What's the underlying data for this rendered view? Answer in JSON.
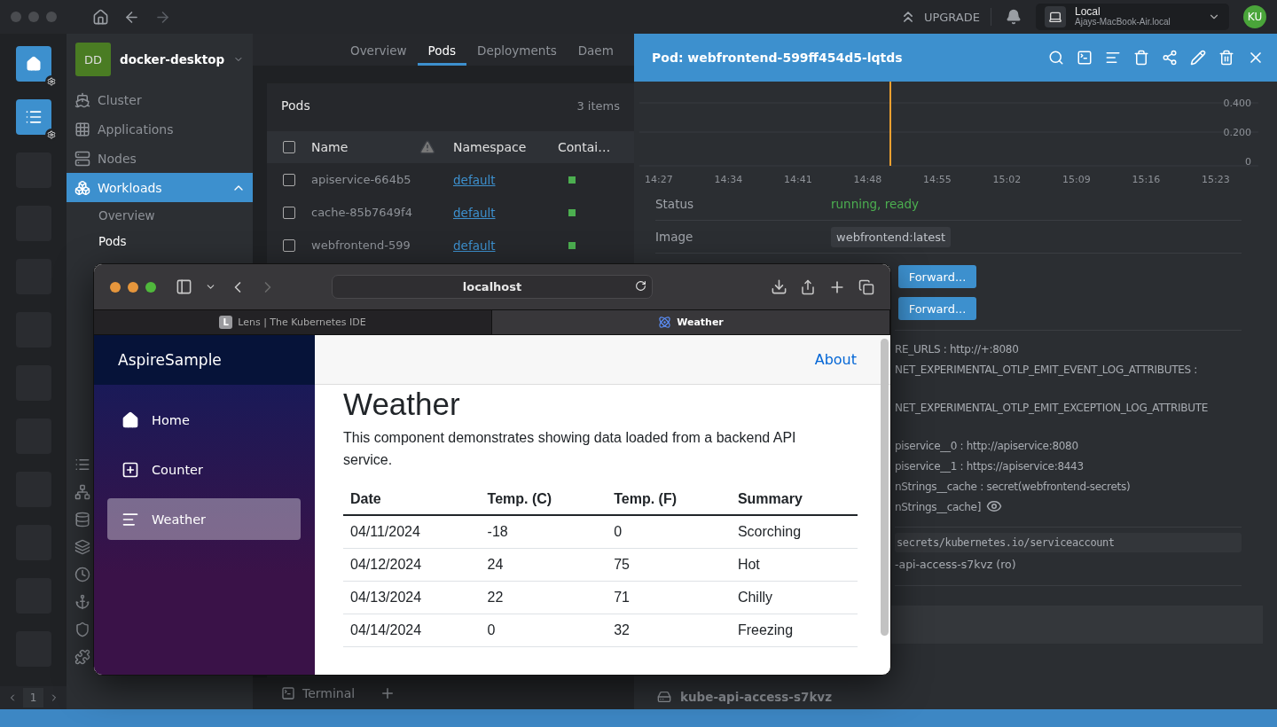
{
  "titlebar": {
    "upgrade_label": "UPGRADE",
    "context": {
      "name": "Local",
      "host": "Ajays-MacBook-Air.local"
    },
    "avatar": "KU"
  },
  "hotbar": {
    "tiles": [
      {
        "kind": "home",
        "selected": true
      },
      {
        "kind": "catalog",
        "selected": true
      },
      {
        "kind": "empty",
        "selected": false
      },
      {
        "kind": "empty",
        "selected": false
      },
      {
        "kind": "empty",
        "selected": false
      },
      {
        "kind": "empty",
        "selected": false
      },
      {
        "kind": "empty",
        "selected": false
      },
      {
        "kind": "empty",
        "selected": false
      },
      {
        "kind": "empty",
        "selected": false
      },
      {
        "kind": "empty",
        "selected": false
      },
      {
        "kind": "empty",
        "selected": false
      },
      {
        "kind": "empty",
        "selected": false
      }
    ],
    "page": "1"
  },
  "sidebar": {
    "cluster": {
      "initials": "DD",
      "name": "docker-desktop"
    },
    "items": [
      {
        "kind": "cluster",
        "label": "Cluster",
        "selected": false
      },
      {
        "kind": "applications",
        "label": "Applications",
        "selected": false
      },
      {
        "kind": "nodes",
        "label": "Nodes",
        "selected": false
      },
      {
        "kind": "workloads",
        "label": "Workloads",
        "selected": true,
        "expanded": true,
        "children": [
          {
            "label": "Overview",
            "selected": false
          },
          {
            "label": "Pods",
            "selected": true
          }
        ]
      }
    ],
    "icon_items": [
      {
        "kind": "config"
      },
      {
        "kind": "network"
      },
      {
        "kind": "storage"
      },
      {
        "kind": "namespaces"
      },
      {
        "kind": "events"
      },
      {
        "kind": "helm"
      },
      {
        "kind": "access"
      },
      {
        "kind": "extensions"
      }
    ]
  },
  "tabs": [
    {
      "label": "Overview",
      "selected": false
    },
    {
      "label": "Pods",
      "selected": true
    },
    {
      "label": "Deployments",
      "selected": false
    },
    {
      "label": "Daem",
      "selected": false
    }
  ],
  "pods": {
    "title": "Pods",
    "count": "3 items",
    "select_all": false,
    "columns": [
      "Name",
      "Namespace",
      "Contai…"
    ],
    "rows": [
      {
        "name": "apiservice-664b5",
        "namespace": "default",
        "checked": false,
        "color": "#4caf50"
      },
      {
        "name": "cache-85b7649f4",
        "namespace": "default",
        "checked": false,
        "color": "#4caf50"
      },
      {
        "name": "webfrontend-599",
        "namespace": "default",
        "checked": false,
        "color": "#4caf50"
      }
    ]
  },
  "dock": {
    "tabs": [
      "Terminal"
    ]
  },
  "details": {
    "title": "Pod: webfrontend-599ff454d5-lqtds",
    "chart": {
      "y_labels": [
        "0.400",
        "0.200",
        "0"
      ],
      "x_labels": [
        "14:27",
        "14:34",
        "14:41",
        "14:48",
        "14:55",
        "15:02",
        "15:09",
        "15:16",
        "15:23"
      ]
    },
    "fields": [
      {
        "label": "Status",
        "value": "running, ready",
        "kind": "status"
      },
      {
        "label": "Image",
        "value": "webfrontend:latest",
        "kind": "badge"
      }
    ],
    "forward_buttons": [
      "Forward...",
      "Forward..."
    ],
    "env": [
      {
        "text": "RE_URLS : http://+:8080",
        "kind": "plain"
      },
      {
        "text": "NET_EXPERIMENTAL_OTLP_EMIT_EVENT_LOG_ATTRIBUTES :",
        "kind": "wrapped"
      },
      {
        "text": "NET_EXPERIMENTAL_OTLP_EMIT_EXCEPTION_LOG_ATTRIBUTE",
        "kind": "wrapped"
      },
      {
        "text": "piservice__0 : http://apiservice:8080",
        "kind": "plain"
      },
      {
        "text": "piservice__1 : https://apiservice:8443",
        "kind": "plain"
      },
      {
        "text": "nStrings__cache : secret(webfrontend-secrets)",
        "kind": "plain"
      },
      {
        "text": "nStrings__cache]",
        "kind": "secret"
      }
    ],
    "mount": {
      "path": "secrets/kubernetes.io/serviceaccount",
      "source": "-api-access-s7kvz (ro)"
    },
    "volume": "kube-api-access-s7kvz"
  },
  "browser": {
    "url": "localhost",
    "tabs": [
      {
        "label": "Lens | The Kubernetes IDE",
        "favicon": "L",
        "selected": false
      },
      {
        "label": "Weather",
        "selected": true
      }
    ],
    "brand": "AspireSample",
    "nav": [
      {
        "kind": "home",
        "label": "Home",
        "selected": false
      },
      {
        "kind": "counter",
        "label": "Counter",
        "selected": false
      },
      {
        "kind": "weather",
        "label": "Weather",
        "selected": true
      }
    ],
    "top_link": "About",
    "heading": "Weather",
    "intro": "This component demonstrates showing data loaded from a backend API service.",
    "table": {
      "columns": [
        "Date",
        "Temp. (C)",
        "Temp. (F)",
        "Summary"
      ],
      "rows": [
        [
          "04/11/2024",
          "-18",
          "0",
          "Scorching"
        ],
        [
          "04/12/2024",
          "24",
          "75",
          "Hot"
        ],
        [
          "04/13/2024",
          "22",
          "71",
          "Chilly"
        ],
        [
          "04/14/2024",
          "0",
          "32",
          "Freezing"
        ]
      ]
    }
  }
}
